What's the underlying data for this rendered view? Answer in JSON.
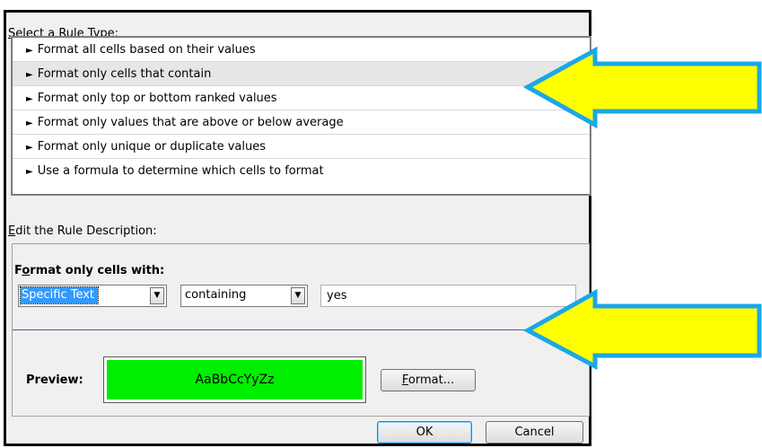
{
  "rule_type": {
    "caption_accesskey": "S",
    "caption_rest": "elect a Rule Type:",
    "items": [
      {
        "label": "Format all cells based on their values"
      },
      {
        "label": "Format only cells that contain"
      },
      {
        "label": "Format only top or bottom ranked values"
      },
      {
        "label": "Format only values that are above or below average"
      },
      {
        "label": "Format only unique or duplicate values"
      },
      {
        "label": "Use a formula to determine which cells to format"
      }
    ],
    "selected_index": 1
  },
  "rule_description": {
    "caption_accesskey": "E",
    "caption_rest": "dit the Rule Description:",
    "heading_part1": "F",
    "heading_accesskey": "o",
    "heading_part2": "rmat only cells with:",
    "condition_type": "Specific Text",
    "operator": "containing",
    "value": "yes"
  },
  "preview": {
    "label": "Preview:",
    "sample_text": "AaBbCcYyZz",
    "fill_color": "#00ee00",
    "format_accesskey": "F",
    "format_rest": "ormat..."
  },
  "buttons": {
    "ok": "OK",
    "cancel": "Cancel"
  },
  "icons": {
    "item_marker": "black-right-pointer",
    "dropdown": "chevron-down-icon"
  },
  "colors": {
    "callout_fill": "#ffff00",
    "callout_outline": "#1aa7e8"
  }
}
